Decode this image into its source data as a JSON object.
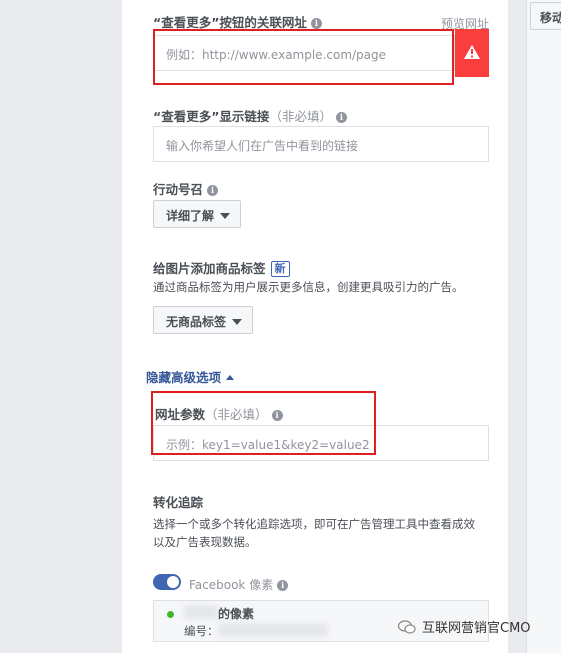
{
  "side_panel": {
    "move_label": "移动"
  },
  "see_more_url": {
    "label": "“查看更多”按钮的关联网址",
    "preview_link": "预览网址",
    "placeholder": "例如：http://www.example.com/page"
  },
  "see_more_display": {
    "label": "“查看更多”显示链接",
    "optional": "（非必填）",
    "placeholder": "输入你希望人们在广告中看到的链接"
  },
  "call_to_action": {
    "label": "行动号召",
    "value": "详细了解"
  },
  "product_tags": {
    "label": "给图片添加商品标签",
    "badge": "新",
    "description": "通过商品标签为用户展示更多信息，创建更具吸引力的广告。",
    "value": "无商品标签"
  },
  "advanced": {
    "toggle_label": "隐藏高级选项"
  },
  "url_params": {
    "label": "网址参数",
    "optional": "（非必填）",
    "placeholder": "示例：key1=value1&key2=value2"
  },
  "conversion": {
    "title": "转化追踪",
    "description_line1": "选择一个或多个转化追踪选项，即可在广告管理工具中查看成效",
    "description_line2": "以及广告表现数据。",
    "pixel_toggle_label": "Facebook 像素",
    "pixel_name_suffix": "的像素",
    "pixel_id_label": "编号："
  },
  "watermark": {
    "text": "互联网营销官CMO"
  },
  "colors": {
    "accent": "#4267b2",
    "error": "#fa3e3e",
    "highlight_box": "#e0201f",
    "status_green": "#42b72a"
  }
}
